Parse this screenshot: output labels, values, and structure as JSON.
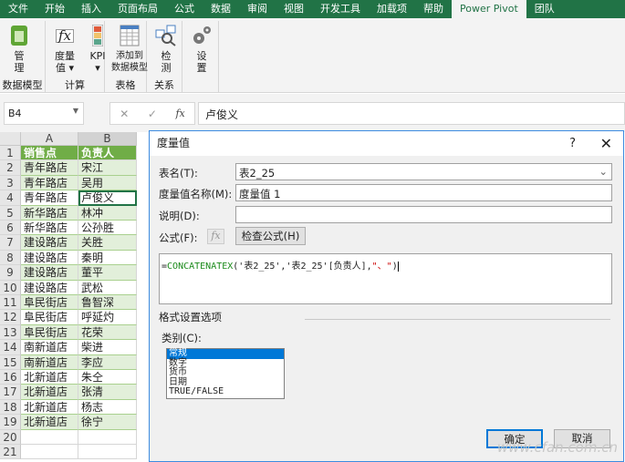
{
  "tabs": [
    "文件",
    "开始",
    "插入",
    "页面布局",
    "公式",
    "数据",
    "审阅",
    "视图",
    "开发工具",
    "加载项",
    "帮助",
    "Power Pivot",
    "团队"
  ],
  "active_tab": "Power Pivot",
  "ribbon": {
    "groups": [
      {
        "label": "数据模型",
        "buttons": [
          {
            "label": "管\n理",
            "icon": "manage-icon"
          }
        ]
      },
      {
        "label": "计算",
        "buttons": [
          {
            "label": "度量\n值 ▾",
            "icon": "fx-icon"
          },
          {
            "label": "KPI\n▾",
            "icon": "kpi-icon"
          }
        ]
      },
      {
        "label": "表格",
        "buttons": [
          {
            "label": "添加到\n数据模型",
            "icon": "table-icon"
          }
        ]
      },
      {
        "label": "关系",
        "buttons": [
          {
            "label": "检\n测",
            "icon": "detect-icon"
          }
        ]
      },
      {
        "label": "",
        "buttons": [
          {
            "label": "设\n置",
            "icon": "gear-icon"
          }
        ]
      }
    ]
  },
  "formula_bar": {
    "name_box": "B4",
    "value": "卢俊义",
    "fx": "fx",
    "cancel": "✕",
    "enter": "✓"
  },
  "sheet": {
    "columns": [
      "A",
      "B"
    ],
    "rows": [
      [
        "销售点",
        "负责人"
      ],
      [
        "青年路店",
        "宋江"
      ],
      [
        "青年路店",
        "吴用"
      ],
      [
        "青年路店",
        "卢俊义"
      ],
      [
        "新华路店",
        "林冲"
      ],
      [
        "新华路店",
        "公孙胜"
      ],
      [
        "建设路店",
        "关胜"
      ],
      [
        "建设路店",
        "秦明"
      ],
      [
        "建设路店",
        "董平"
      ],
      [
        "建设路店",
        "武松"
      ],
      [
        "阜民街店",
        "鲁智深"
      ],
      [
        "阜民街店",
        "呼延灼"
      ],
      [
        "阜民街店",
        "花荣"
      ],
      [
        "南新道店",
        "柴进"
      ],
      [
        "南新道店",
        "李应"
      ],
      [
        "北新道店",
        "朱仝"
      ],
      [
        "北新道店",
        "张清"
      ],
      [
        "北新道店",
        "杨志"
      ],
      [
        "北新道店",
        "徐宁"
      ],
      [
        "",
        ""
      ],
      [
        "",
        ""
      ]
    ]
  },
  "dialog": {
    "title": "度量值",
    "help": "?",
    "close": "✕",
    "table_label": "表名(T):",
    "table_value": "表2_25",
    "name_label": "度量值名称(M):",
    "name_value": "度量值 1",
    "desc_label": "说明(D):",
    "desc_value": "",
    "formula_label": "公式(F):",
    "fx": "fx",
    "check_btn": "检查公式(H)",
    "formula": {
      "p1": "=",
      "func": "CONCATENATEX",
      "p2": "('表2_25','表2_25'[负责人],",
      "str": "\"、\"",
      "p3": ")"
    },
    "format_section": "格式设置选项",
    "category_label": "类别(C):",
    "categories": [
      "常规",
      "数字",
      "货币",
      "日期",
      "TRUE/FALSE"
    ],
    "selected_category": "常规",
    "ok": "确定",
    "cancel": "取消",
    "watermark": "www.cfan.com.cn"
  }
}
